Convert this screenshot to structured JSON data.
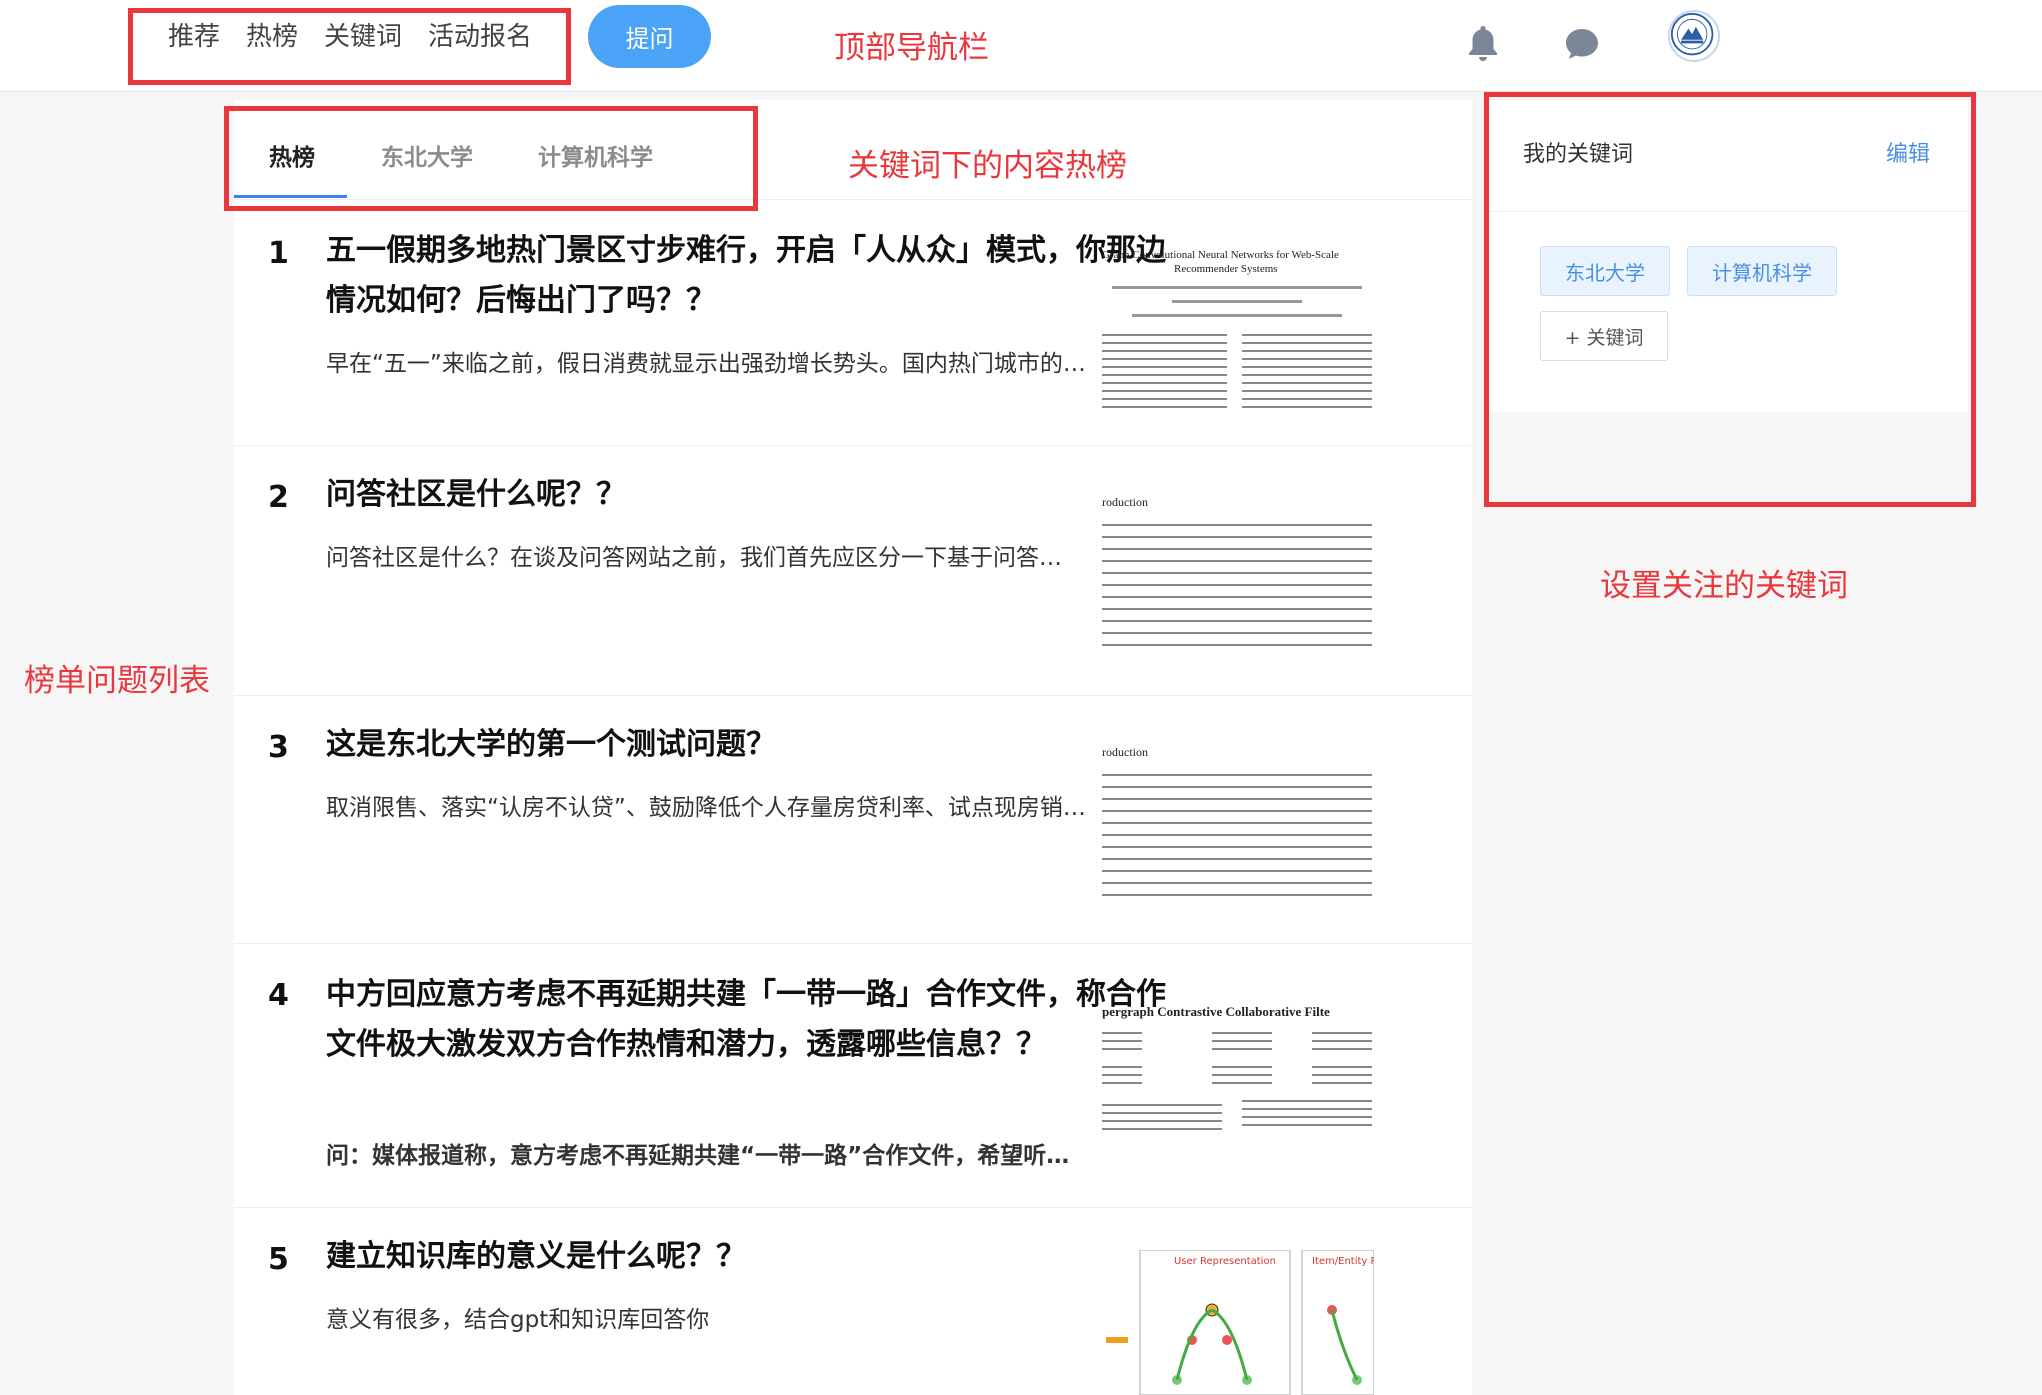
{
  "nav": {
    "items": [
      "推荐",
      "热榜",
      "关键词",
      "活动报名"
    ],
    "ask_label": "提问"
  },
  "tabs": [
    "热榜",
    "东北大学",
    "计算机科学"
  ],
  "questions": [
    {
      "rank": "1",
      "title": "五一假期多地热门景区寸步难行，开启「人从众」模式，你那边情况如何？后悔出门了吗？？",
      "excerpt": "早在“五一”来临之前，假日消费就显示出强劲增长势头。国内热门城市的酒店、机票、门票预订量大增",
      "excerpt_bold": false,
      "thumb_title": "Graph Convolutional Neural Networks for Web-Scale Recommender Systems"
    },
    {
      "rank": "2",
      "title": "问答社区是什么呢？？",
      "excerpt": "问答社区是什么？在谈及问答网站之前，我们首先应区分一下基于问答的社区和传统社区的区别",
      "excerpt_bold": false,
      "thumb_title": "Introduction"
    },
    {
      "rank": "3",
      "title": "这是东北大学的第一个测试问题？",
      "excerpt": "取消限售、落实“认房不认贷”、鼓励降低个人存量房贷利率、试点现房销售等政策",
      "excerpt_bold": false,
      "thumb_title": "Introduction"
    },
    {
      "rank": "4",
      "title": "中方回应意方考虑不再延期共建「一带一路」合作文件，称合作文件极大激发双方合作热情和潜力，透露哪些信息？？",
      "excerpt": "问：媒体报道称，意方考虑不再延期共建“一带一路”合作文件，希望听取中方的看法",
      "excerpt_bold": true,
      "thumb_title": "Hypergraph Contrastive Collaborative Filtering"
    },
    {
      "rank": "5",
      "title": "建立知识库的意义是什么呢？？",
      "excerpt": "意义有很多，结合gpt和知识库回答你",
      "excerpt_bold": false,
      "thumb_title": "User Representation"
    }
  ],
  "sidebar": {
    "title": "我的关键词",
    "edit_label": "编辑",
    "keywords": [
      "东北大学",
      "计算机科学"
    ],
    "add_label": "+ 关键词"
  },
  "annotations": {
    "top_nav": "顶部导航栏",
    "keyword_hot": "关键词下的内容热榜",
    "list": "榜单问题列表",
    "keyword_setting": "设置关注的关键词"
  },
  "colors": {
    "accent": "#4aa3f6",
    "annotation_red": "#e8383d",
    "keyword_blue": "#4a90e2"
  }
}
